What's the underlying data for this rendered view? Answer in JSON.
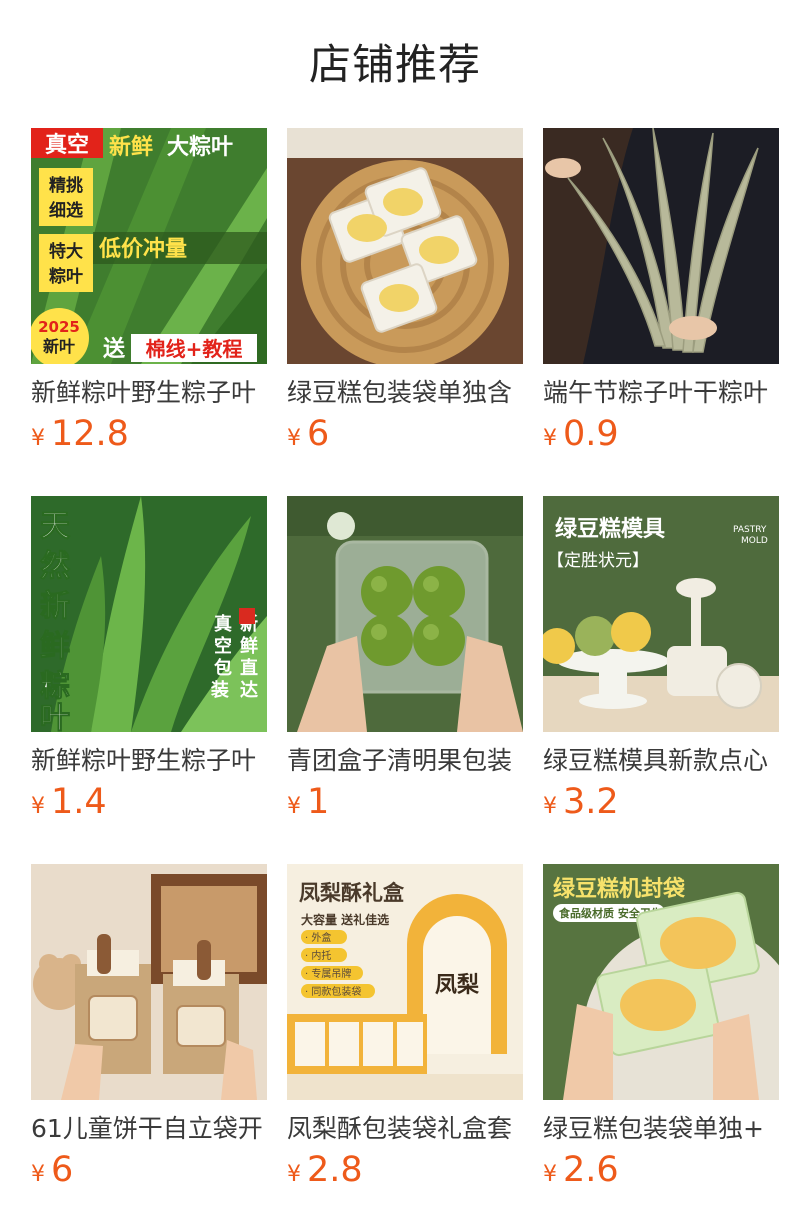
{
  "section": {
    "title": "店铺推荐"
  },
  "colors": {
    "price": "#ee5a1a",
    "title": "#222222",
    "text": "#3a3a3a"
  },
  "products": [
    {
      "name": "新鲜粽叶野生粽子叶",
      "currency": "¥",
      "price": "12.8",
      "image_text": {
        "vacuum": "真空",
        "fresh": "新鲜",
        "big_leaf": "大粽叶",
        "select": "精挑细选",
        "large": "特大粽叶",
        "cheap": "低价冲量",
        "year": "2025新叶",
        "gift": "送",
        "gift_detail": "棉线+教程"
      }
    },
    {
      "name": "绿豆糕包装袋单独含",
      "currency": "¥",
      "price": "6"
    },
    {
      "name": "端午节粽子叶干粽叶",
      "currency": "¥",
      "price": "0.9"
    },
    {
      "name": "新鲜粽叶野生粽子叶",
      "currency": "¥",
      "price": "1.4",
      "image_text": {
        "headline": "天然新鲜粽叶",
        "pack": "真空包装",
        "fresh": "新鲜直达"
      }
    },
    {
      "name": "青团盒子清明果包装",
      "currency": "¥",
      "price": "1"
    },
    {
      "name": "绿豆糕模具新款点心",
      "currency": "¥",
      "price": "3.2",
      "image_text": {
        "title": "绿豆糕模具",
        "subtitle": "【定胜状元】",
        "en": "PASTRY MOLD"
      }
    },
    {
      "name": "61儿童饼干自立袋开",
      "currency": "¥",
      "price": "6"
    },
    {
      "name": "凤梨酥包装袋礼盒套",
      "currency": "¥",
      "price": "2.8",
      "image_text": {
        "title": "凤梨酥礼盒",
        "sub": "大容量 送礼佳选",
        "items": [
          "· 外盒",
          "· 内托",
          "· 专属吊牌",
          "· 同款包装袋"
        ]
      }
    },
    {
      "name": "绿豆糕包装袋单独+",
      "currency": "¥",
      "price": "2.6",
      "image_text": {
        "title": "绿豆糕机封袋",
        "sub": "食品级材质 安全卫生"
      }
    }
  ]
}
